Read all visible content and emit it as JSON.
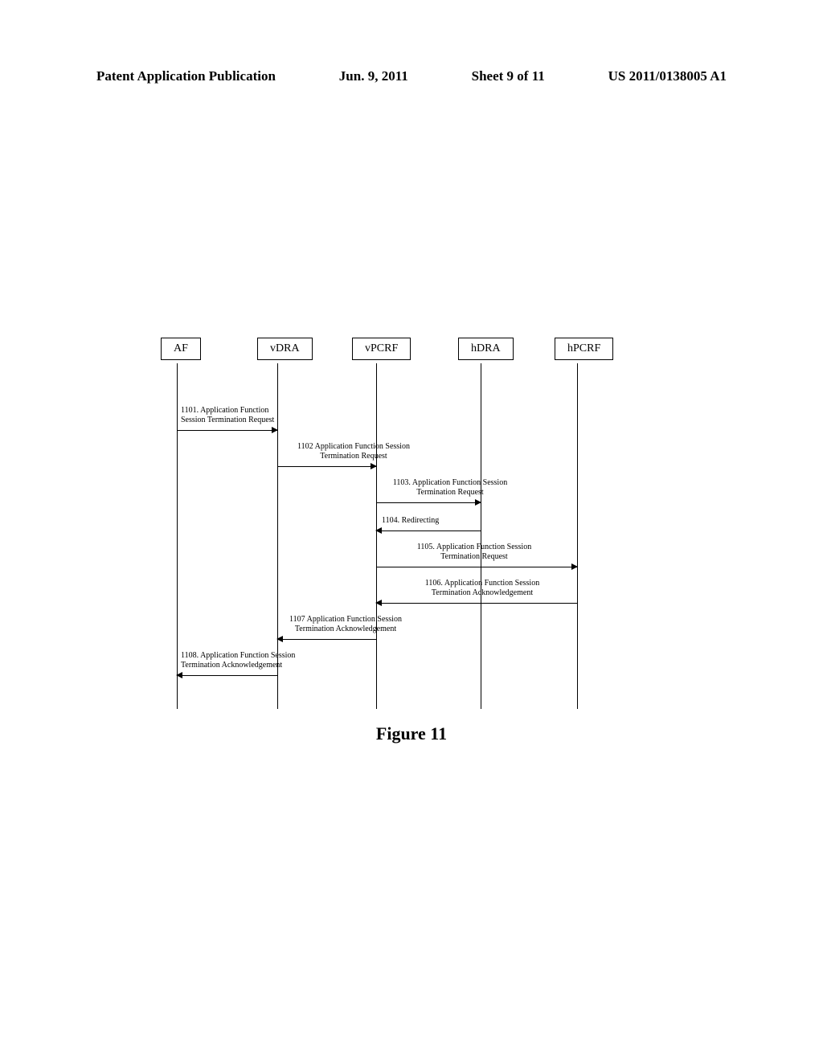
{
  "header": {
    "publication_type": "Patent Application Publication",
    "date": "Jun. 9, 2011",
    "sheet": "Sheet 9 of 11",
    "pub_number": "US 2011/0138005 A1"
  },
  "diagram": {
    "actors": {
      "af": "AF",
      "vdra": "vDRA",
      "vpcrf": "vPCRF",
      "hdra": "hDRA",
      "hpcrf": "hPCRF"
    },
    "messages": {
      "m1101": "1101. Application Function\nSession Termination Request",
      "m1102": "1102  Application Function Session\nTermination Request",
      "m1103": "1103. Application Function Session\nTermination Request",
      "m1104": "1104. Redirecting",
      "m1105": "1105. Application Function Session\nTermination Request",
      "m1106": "1106. Application Function Session\nTermination Acknowledgement",
      "m1107": "1107  Application Function Session\nTermination Acknowledgement",
      "m1108": "1108. Application Function Session\nTermination Acknowledgement"
    }
  },
  "figure_caption": "Figure 11"
}
